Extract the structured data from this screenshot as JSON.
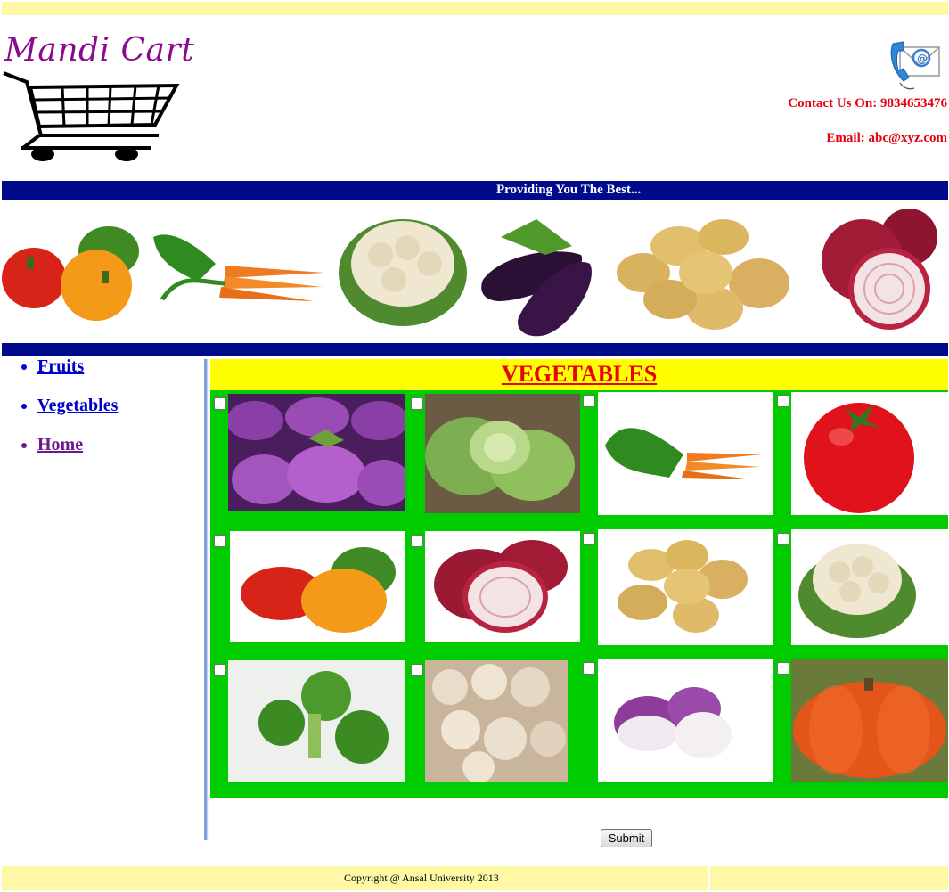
{
  "site": {
    "title": "Mandi Cart",
    "contact_label": "Contact Us On: 9834653476",
    "email_label": "Email: abc@xyz.com",
    "tagline": "Providing You The Best..."
  },
  "nav": {
    "items": [
      {
        "label": "Fruits",
        "color": "#0000cc"
      },
      {
        "label": "Vegetables",
        "color": "#0000cc"
      },
      {
        "label": "Home",
        "color": "#6a1b8a"
      }
    ]
  },
  "section": {
    "heading": "VEGETABLES"
  },
  "products": [
    {
      "name": "brinjal-image"
    },
    {
      "name": "cabbage-image"
    },
    {
      "name": "carrot-image"
    },
    {
      "name": "tomato-image"
    },
    {
      "name": "bell-pepper-image"
    },
    {
      "name": "onion-image"
    },
    {
      "name": "potato-image"
    },
    {
      "name": "cauliflower-image"
    },
    {
      "name": "broccoli-image"
    },
    {
      "name": "mushroom-image"
    },
    {
      "name": "turnip-image"
    },
    {
      "name": "pumpkin-image"
    }
  ],
  "form": {
    "submit_label": "Submit"
  },
  "footer": {
    "copyright": "Copyright @ Ansal University 2013"
  },
  "colors": {
    "banner_blue": "#000a8c",
    "grid_green": "#00cc00",
    "heading_yellow": "#ffff00",
    "accent_red": "#e8000e",
    "footer_yellow": "#fff9a6"
  }
}
